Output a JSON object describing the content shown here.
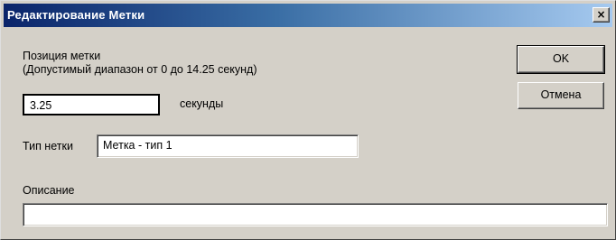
{
  "window": {
    "title": "Редактирование Метки",
    "close_label": "×"
  },
  "position": {
    "label": "Позиция метки",
    "range_hint": "(Допустимый диапазон от 0 до 14.25 секунд)",
    "value": "3.25",
    "unit": "секунды"
  },
  "mark_type": {
    "label": "Тип нетки",
    "value": "Метка - тип  1"
  },
  "description": {
    "label": "Описание",
    "value": ""
  },
  "buttons": {
    "ok": "OK",
    "cancel": "Отмена"
  }
}
